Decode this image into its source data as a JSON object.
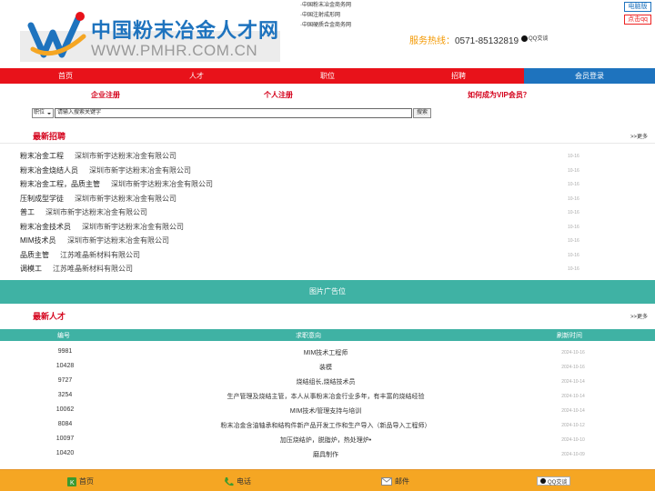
{
  "header": {
    "logo_cn": "中国粉末冶金人才网",
    "logo_en": "WWW.PMHR.COM.CN",
    "site_links": [
      "·中国粉末冶金商务网",
      "·中国注射成形网",
      "·中国硬质合金商务网"
    ],
    "pc_version": "电脑版",
    "click_qq": "点击qq",
    "hotline_label": "服务热线：",
    "hotline_number": "0571-85132819",
    "qq_chat": "QQ交谈"
  },
  "nav": {
    "items": [
      "首页",
      "人才",
      "职位",
      "招聘",
      "会员登录"
    ]
  },
  "sublinks": {
    "company_register": "企业注册",
    "personal_register": "个人注册",
    "vip": "如何成为VIP会员？"
  },
  "search": {
    "select_value": "职位",
    "input_value": "请输入搜索关键字",
    "button": "搜索"
  },
  "recruit": {
    "title": "最新招聘",
    "more": ">>更多",
    "jobs": [
      {
        "title": "粉末冶金工程",
        "company": "深圳市新宇达粉末冶金有限公司",
        "date": "10-16"
      },
      {
        "title": "粉末冶金烧结人员",
        "company": "深圳市新宇达粉末冶金有限公司",
        "date": "10-16"
      },
      {
        "title": "粉末冶金工程，品质主管",
        "company": "深圳市新宇达粉末冶金有限公司",
        "date": "10-16"
      },
      {
        "title": "压制成型学徒",
        "company": "深圳市新宇达粉末冶金有限公司",
        "date": "10-16"
      },
      {
        "title": "普工",
        "company": "深圳市新宇达粉末冶金有限公司",
        "date": "10-16"
      },
      {
        "title": "粉末冶金技术员",
        "company": "深圳市新宇达粉末冶金有限公司",
        "date": "10-16"
      },
      {
        "title": "MIM技术员",
        "company": "深圳市新宇达粉末冶金有限公司",
        "date": "10-16"
      },
      {
        "title": "品质主管",
        "company": "江苏唯晶新材料有限公司",
        "date": "10-16"
      },
      {
        "title": "调模工",
        "company": "江苏唯晶新材料有限公司",
        "date": "10-16"
      }
    ]
  },
  "ad": {
    "label": "图片广告位"
  },
  "talent": {
    "title": "最新人才",
    "more": ">>更多",
    "headers": [
      "编号",
      "求职意向",
      "刷新时间"
    ],
    "rows": [
      {
        "id": "9981",
        "intent": "MIM技术工程师",
        "time": "2024-10-16"
      },
      {
        "id": "10428",
        "intent": "装模",
        "time": "2024-10-16"
      },
      {
        "id": "9727",
        "intent": "烧结组长,烧结技术员",
        "time": "2024-10-14"
      },
      {
        "id": "3254",
        "intent": "生产管理及烧结主管，本人从事粉末冶金行业多年，有丰富的烧结经验",
        "time": "2024-10-14"
      },
      {
        "id": "10062",
        "intent": "MIM技术/管理支持与培训",
        "time": "2024-10-14"
      },
      {
        "id": "8084",
        "intent": "粉末冶金含油轴承和结构件新产品开发工作和生产导入（新品导入工程师）",
        "time": "2024-10-12"
      },
      {
        "id": "10097",
        "intent": "加压烧结炉，脱脂炉，热处理炉•",
        "time": "2024-10-10"
      },
      {
        "id": "10420",
        "intent": "磨具制作",
        "time": "2024-10-09"
      }
    ]
  },
  "footer": {
    "home": "首页",
    "phone": "电话",
    "mail": "邮件",
    "qq": "QQ交谈"
  },
  "colors": {
    "nav_red": "#e8121a",
    "login_blue": "#1e73be",
    "teal": "#3fb2a4",
    "footer_orange": "#f5a623",
    "section_red": "#d4001a"
  }
}
